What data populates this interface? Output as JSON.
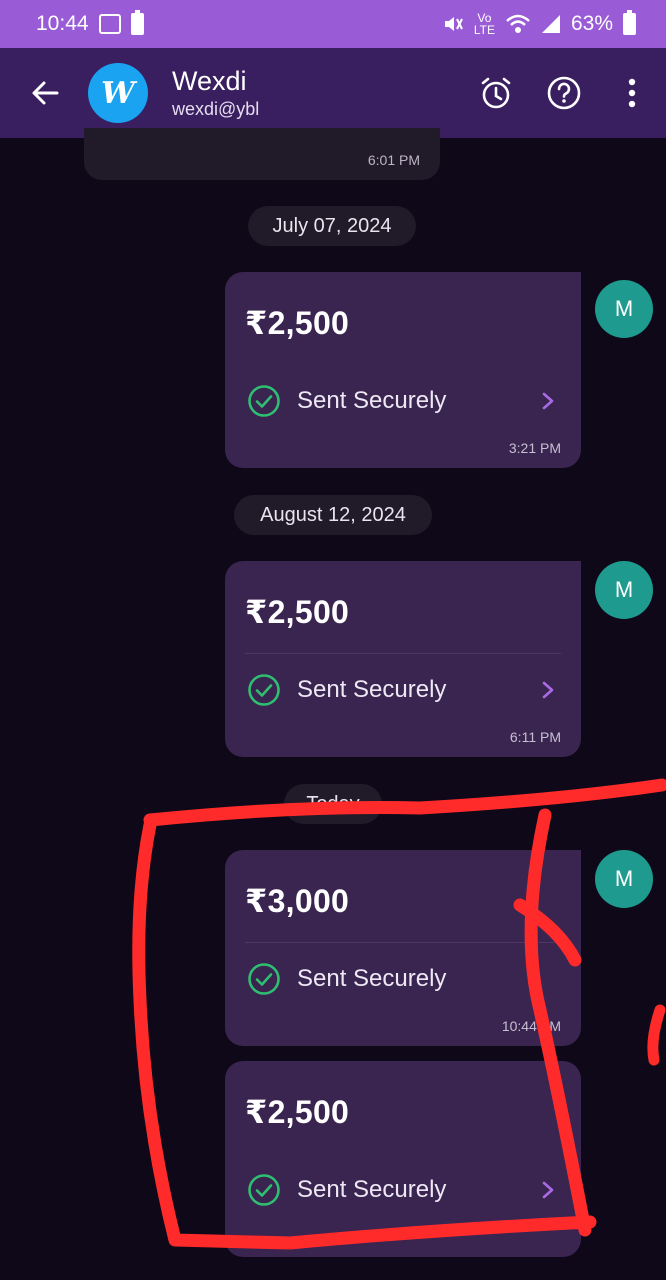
{
  "status_bar": {
    "time": "10:44",
    "battery": "63%",
    "network": "Vo\nLTE"
  },
  "header": {
    "contact_name": "Wexdi",
    "contact_upi": "wexdi@ybl",
    "logo_text": "W"
  },
  "chat": {
    "first_message_time": "6:01 PM",
    "dates": [
      "July 07, 2024",
      "August 12, 2024",
      "Today"
    ],
    "avatar_letter": "M",
    "payments": [
      {
        "amount": "₹2,500",
        "status": "Sent Securely",
        "time": "3:21 PM"
      },
      {
        "amount": "₹2,500",
        "status": "Sent Securely",
        "time": "6:11 PM"
      },
      {
        "amount": "₹3,000",
        "status": "Sent Securely",
        "time": "10:44 AM"
      },
      {
        "amount": "₹2,500",
        "status": "Sent Securely",
        "time": ""
      }
    ]
  },
  "colors": {
    "status_bar": "#9a5cd6",
    "header": "#3a1f60",
    "background": "#0f0818",
    "bubble": "#3a2450",
    "success": "#2fbf71",
    "avatar": "#1e9a8f",
    "annotation": "#ff2b2b"
  }
}
